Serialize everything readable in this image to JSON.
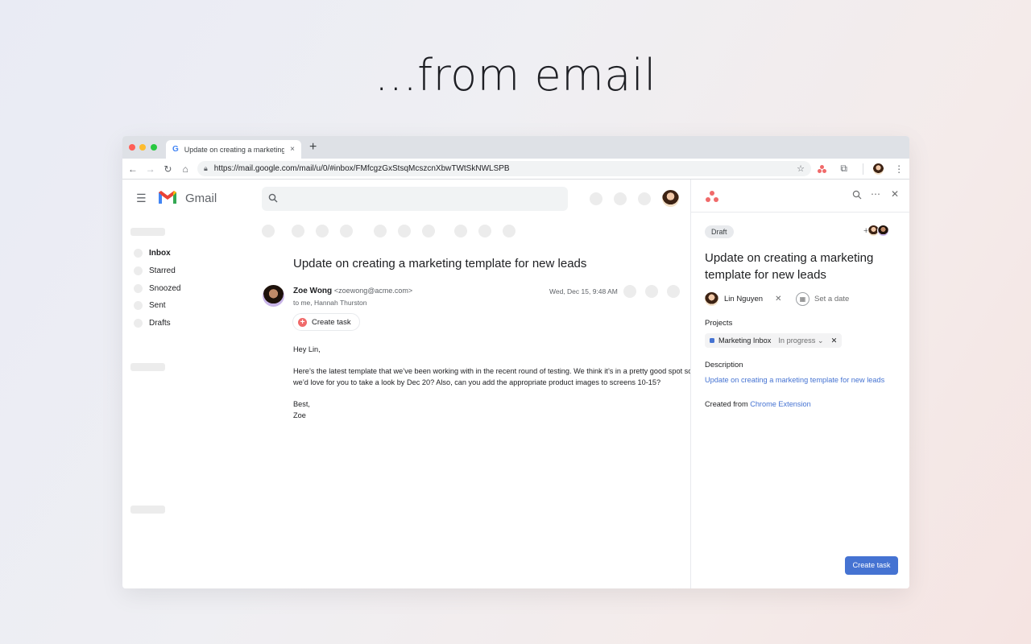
{
  "headline": "...from email",
  "browser": {
    "tab_title": "Update on creating a marketing t",
    "tab_close": "×",
    "new_tab": "+",
    "url": "https://mail.google.com/mail/u/0/#inbox/FMfcgzGxStsqMcszcnXbwTWtSkNWLSPB"
  },
  "gmail": {
    "app_name": "Gmail",
    "sidebar": {
      "items": [
        {
          "label": "Inbox",
          "active": true
        },
        {
          "label": "Starred",
          "active": false
        },
        {
          "label": "Snoozed",
          "active": false
        },
        {
          "label": "Sent",
          "active": false
        },
        {
          "label": "Drafts",
          "active": false
        }
      ]
    },
    "email": {
      "subject": "Update on creating a marketing template for new leads",
      "sender_name": "Zoe Wong",
      "sender_email": "<zoewong@acme.com>",
      "recipients": "to me, Hannah Thurston",
      "date": "Wed, Dec 15, 9:48 AM",
      "create_task_label": "Create task",
      "body": {
        "greeting": "Hey Lin,",
        "line1": "Here’s the latest template that we’ve been working with in the recent round of testing. We think it’s in a pretty good spot so",
        "line2": "we’d love for you to take a look by Dec 20? Also, can you add the appropriate product images to screens 10-15?",
        "signoff": "Best,",
        "signature": "Zoe"
      }
    }
  },
  "asana": {
    "status_badge": "Draft",
    "task_title": "Update on creating a marketing template for new leads",
    "assignee": "Lin Nguyen",
    "due_date_placeholder": "Set a date",
    "projects_label": "Projects",
    "project": {
      "name": "Marketing Inbox",
      "status": "In progress",
      "color": "#4573d2"
    },
    "description_label": "Description",
    "description_link": "Update on creating a marketing template for new leads",
    "created_from_prefix": "Created from",
    "created_from_link": "Chrome Extension",
    "create_button": "Create task"
  },
  "colors": {
    "asana_coral": "#f06a6a",
    "asana_blue": "#4573d2",
    "gmail_red": "#ea4335"
  },
  "icons": {
    "tab_favicon": "google-g-icon",
    "nav": [
      "back-arrow-icon",
      "forward-arrow-icon",
      "reload-icon",
      "home-icon"
    ],
    "address": [
      "lock-icon",
      "bookmark-star-icon"
    ],
    "extensions": [
      "asana-extension-icon",
      "puzzle-extensions-icon",
      "profile-avatar",
      "kebab-menu-icon"
    ],
    "asana_header": [
      "search-icon",
      "more-horizontal-icon",
      "close-icon"
    ]
  }
}
